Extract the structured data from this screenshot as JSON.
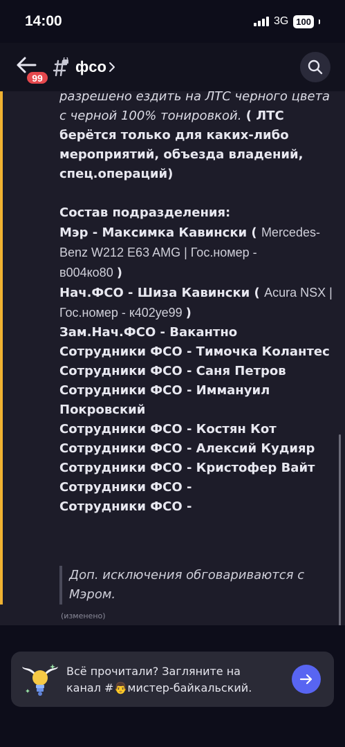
{
  "status_bar": {
    "time": "14:00",
    "network": "3G",
    "battery": "100"
  },
  "header": {
    "back_badge": "99",
    "channel_name": "фсо"
  },
  "message": {
    "lines": [
      {
        "segments": [
          {
            "text": "разрешено ездить на ЛТС черного цвета",
            "style": "italic"
          }
        ]
      },
      {
        "segments": [
          {
            "text": "с черной 100% тонировкой.",
            "style": "italic"
          },
          {
            "text": "  ( ЛТС",
            "style": "bold"
          }
        ]
      },
      {
        "segments": [
          {
            "text": "берётся только для каких-либо",
            "style": "bold"
          }
        ]
      },
      {
        "segments": [
          {
            "text": "мероприятий, объезда владений,",
            "style": "bold"
          }
        ]
      },
      {
        "segments": [
          {
            "text": "спец.операций)",
            "style": "bold"
          }
        ]
      },
      {
        "segments": [
          {
            "text": "",
            "style": "bold"
          }
        ]
      },
      {
        "segments": [
          {
            "text": "Состав подразделения:",
            "style": "bold"
          }
        ]
      },
      {
        "segments": [
          {
            "text": "Мэр - Максимка Кавински ( ",
            "style": "bold"
          },
          {
            "text": "Mercedes-",
            "style": "light"
          }
        ]
      },
      {
        "segments": [
          {
            "text": "Benz W212 E63 AMG | Гос.номер -",
            "style": "light"
          }
        ]
      },
      {
        "segments": [
          {
            "text": "в004ко80 ",
            "style": "light"
          },
          {
            "text": ")",
            "style": "bold"
          }
        ]
      },
      {
        "segments": [
          {
            "text": "Нач.ФСО -  Шиза Кавински ( ",
            "style": "bold"
          },
          {
            "text": " Acura NSX |",
            "style": "light"
          }
        ]
      },
      {
        "segments": [
          {
            "text": "Гос.номер - к402уе99 ",
            "style": "light"
          },
          {
            "text": " )",
            "style": "bold"
          }
        ]
      },
      {
        "segments": [
          {
            "text": "Зам.Нач.ФСО - Вакантно",
            "style": "bold"
          }
        ]
      },
      {
        "segments": [
          {
            "text": "Сотрудники ФСО - Тимочка Колантес",
            "style": "bold"
          }
        ]
      },
      {
        "segments": [
          {
            "text": "Сотрудники ФСО - Саня Петров",
            "style": "bold"
          }
        ]
      },
      {
        "segments": [
          {
            "text": "Сотрудники ФСО - Иммануил",
            "style": "bold"
          }
        ]
      },
      {
        "segments": [
          {
            "text": "Покровский",
            "style": "bold"
          }
        ]
      },
      {
        "segments": [
          {
            "text": "Сотрудники ФСО - Костян Кот",
            "style": "bold"
          }
        ]
      },
      {
        "segments": [
          {
            "text": "Сотрудники ФСО - Алексий Кудияр",
            "style": "bold"
          }
        ]
      },
      {
        "segments": [
          {
            "text": "Сотрудники ФСО - Кристофер Вайт",
            "style": "bold"
          }
        ]
      },
      {
        "segments": [
          {
            "text": "Сотрудники ФСО -",
            "style": "bold"
          }
        ]
      },
      {
        "segments": [
          {
            "text": "Сотрудники ФСО -",
            "style": "bold"
          }
        ]
      }
    ],
    "quote_lines": [
      "Доп. исключения обговариваются с",
      "Мэром."
    ],
    "edited_label": "(изменено)"
  },
  "notice": {
    "line1": "Всё прочитали? Загляните на",
    "line2": "канал #👨мистер-байкальский."
  },
  "colors": {
    "accent": "#f0b232",
    "brand": "#5865f2",
    "badge": "#e5484d"
  },
  "icons": [
    "back-arrow-icon",
    "channel-hash-lock-icon",
    "chevron-right-icon",
    "search-icon",
    "arrow-right-icon",
    "winged-bulb-illustration"
  ]
}
